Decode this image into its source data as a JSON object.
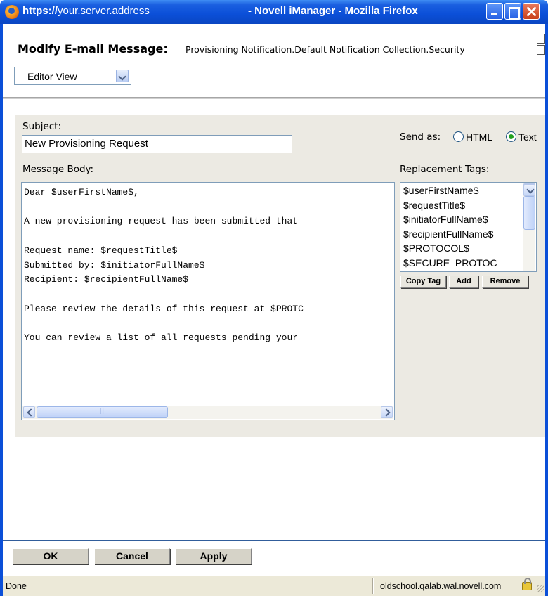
{
  "window": {
    "url": "https://your.server.address",
    "url_scheme": "https://",
    "url_host": "your.server.address",
    "title": "- Novell iManager - Mozilla Firefox"
  },
  "header": {
    "heading": "Modify E-mail Message:",
    "object_path": "Provisioning Notification.Default Notification Collection.Security",
    "view_select": {
      "selected": "Editor View"
    }
  },
  "form": {
    "subject_label": "Subject:",
    "subject_value": "New Provisioning Request",
    "send_as": {
      "label": "Send as:",
      "options": [
        {
          "label": "HTML",
          "selected": false
        },
        {
          "label": "Text",
          "selected": true
        }
      ]
    },
    "body_label": "Message Body:",
    "body_lines": [
      "Dear $userFirstName$,",
      "",
      "A new provisioning request has been submitted that",
      "",
      "Request name: $requestTitle$",
      "Submitted by: $initiatorFullName$",
      "Recipient: $recipientFullName$",
      "",
      "Please review the details of this request at $PROTC",
      "",
      "You can review a list of all requests pending your"
    ],
    "tags_label": "Replacement Tags:",
    "tags": [
      "$userFirstName$",
      "$requestTitle$",
      "$initiatorFullName$",
      "$recipientFullName$",
      "$PROTOCOL$",
      "$SECURE_PROTOC"
    ],
    "tag_buttons": {
      "copy": "Copy Tag",
      "add": "Add",
      "remove": "Remove"
    }
  },
  "footer": {
    "ok": "OK",
    "cancel": "Cancel",
    "apply": "Apply"
  },
  "statusbar": {
    "status": "Done",
    "host": "oldschool.qalab.wal.novell.com"
  },
  "colors": {
    "titlebar": "#0b4fd8",
    "panel_bg": "#eceae3",
    "selected_radio": "#21a121",
    "field_border": "#7f9db9"
  },
  "icons": [
    "firefox-icon",
    "minimize-icon",
    "maximize-icon",
    "close-icon",
    "help-icon",
    "chevron-down-icon",
    "lock-icon"
  ]
}
